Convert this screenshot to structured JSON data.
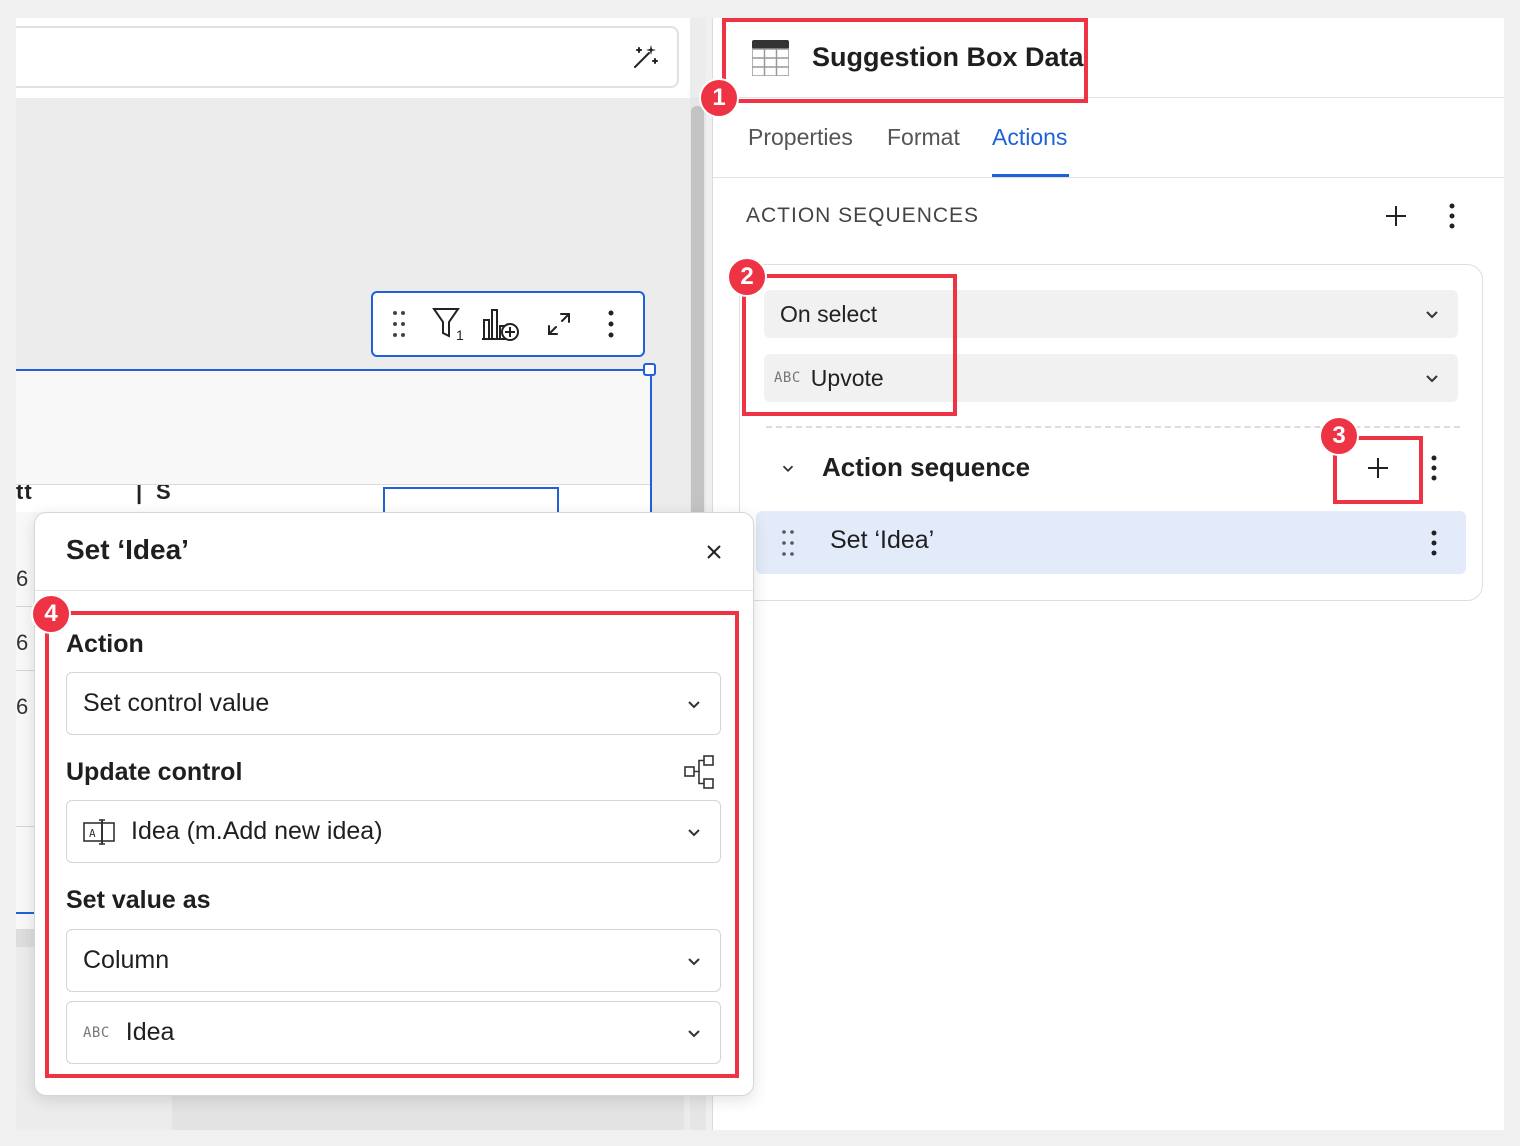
{
  "panel": {
    "title": "Suggestion Box Data",
    "tabs": [
      "Properties",
      "Format",
      "Actions"
    ],
    "active_tab": "Actions"
  },
  "action_sequences": {
    "section_label": "ACTION SEQUENCES",
    "trigger": "On select",
    "column_type": "ABC",
    "column": "Upvote",
    "sequence_title": "Action sequence",
    "actions": [
      {
        "label": "Set ‘Idea’"
      }
    ]
  },
  "toolbar": {
    "filter_count": "1"
  },
  "table": {
    "row_numbers": [
      "6",
      "6",
      "6"
    ]
  },
  "popover": {
    "title": "Set ‘Idea’",
    "action_label": "Action",
    "action_value": "Set control value",
    "update_control_label": "Update control",
    "update_control_value": "Idea (m.Add new idea)",
    "set_value_label": "Set value as",
    "set_value_source": "Column",
    "set_value_column_type": "ABC",
    "set_value_column": "Idea"
  },
  "annotations": [
    "1",
    "2",
    "3",
    "4"
  ],
  "colors": {
    "accent": "#1d62d6",
    "selection": "#2161d8",
    "annotation": "#ee3344",
    "row_highlight": "#e3eaf9"
  }
}
